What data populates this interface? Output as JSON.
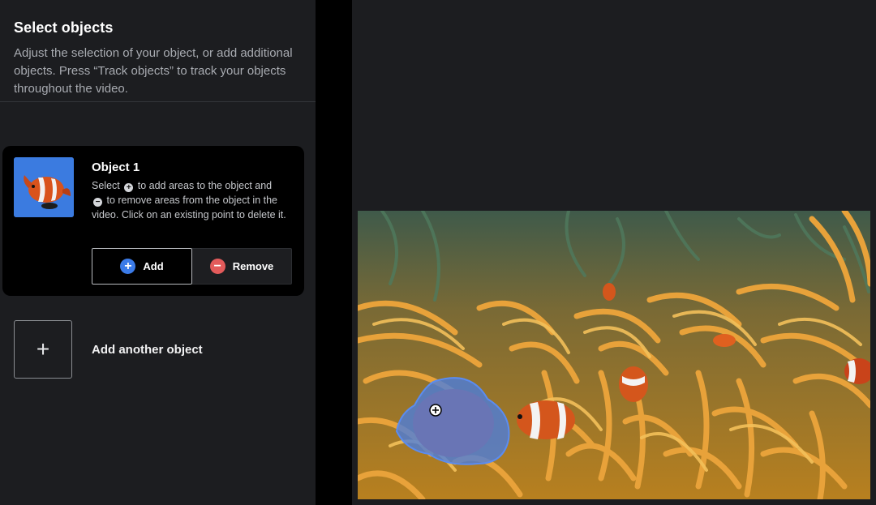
{
  "panel": {
    "title": "Select objects",
    "description": "Adjust the selection of your object, or add additional objects. Press “Track objects” to track your objects throughout the video."
  },
  "object": {
    "title": "Object 1",
    "help_part1": "Select",
    "help_part2": "to add areas to the object and",
    "help_part3": "to remove areas from the object in the video. Click on an existing point to delete it.",
    "add_label": "Add",
    "remove_label": "Remove"
  },
  "add_another": {
    "label": "Add another object"
  },
  "icons": {
    "add": "plus-circle-icon",
    "remove": "minus-circle-icon",
    "add_another": "plus-icon",
    "point": "plus-point-icon"
  },
  "colors": {
    "accent_blue": "#3b7be8",
    "remove_red": "#e35b5b",
    "mask_blue": "#4a7ee0",
    "panel_bg": "#1c1d20"
  }
}
